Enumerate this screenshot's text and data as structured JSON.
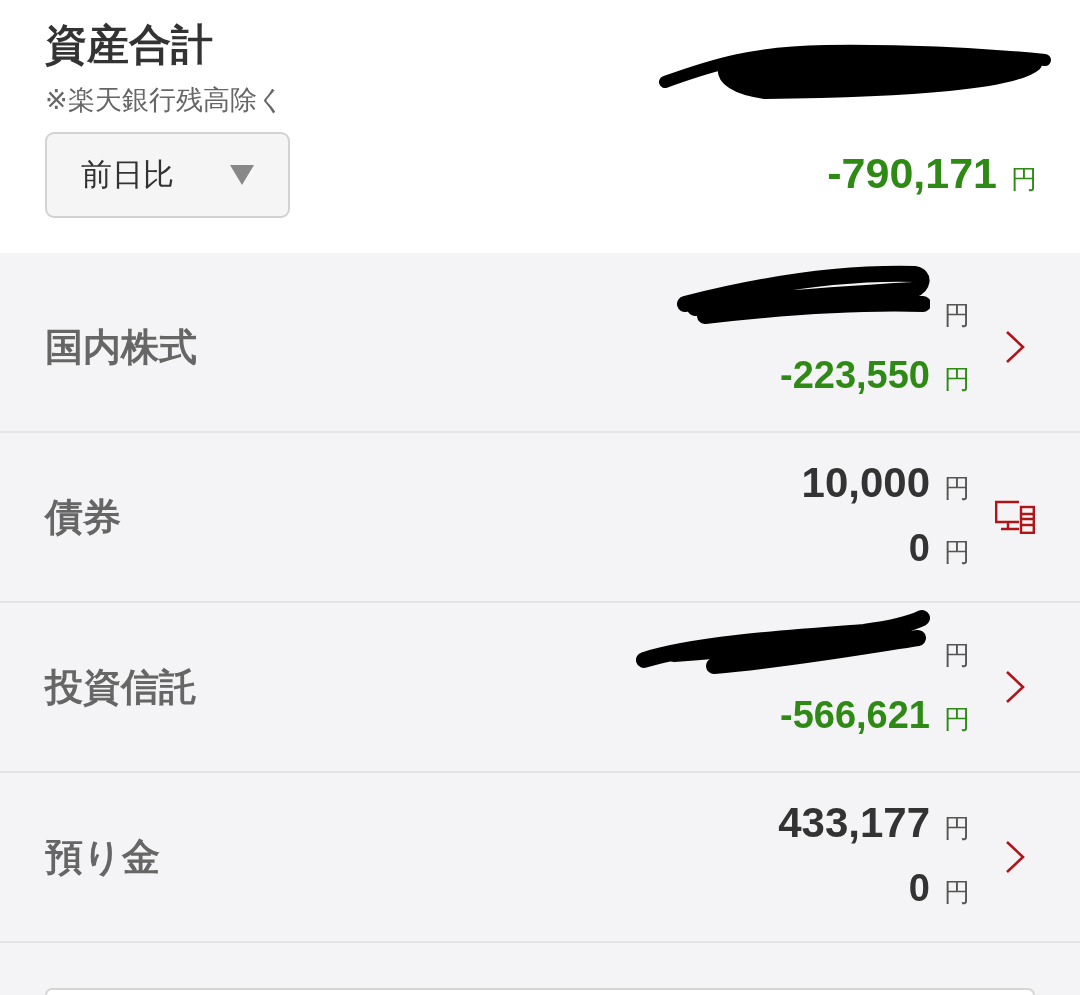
{
  "summary": {
    "title": "資産合計",
    "note": "※楽天銀行残高除く",
    "comparison": {
      "value": "前日比"
    },
    "total": {
      "redacted": true
    },
    "change": {
      "value": "-790,171",
      "unit": "円",
      "negative": true
    }
  },
  "assets": [
    {
      "label": "国内株式",
      "kind": "link",
      "amount": {
        "redacted": true,
        "unit": "円"
      },
      "change": {
        "value": "-223,550",
        "unit": "円",
        "negative": true
      }
    },
    {
      "label": "債券",
      "kind": "desktop",
      "amount": {
        "redacted": false,
        "value": "10,000",
        "unit": "円"
      },
      "change": {
        "value": "0",
        "unit": "円",
        "negative": false
      }
    },
    {
      "label": "投資信託",
      "kind": "link",
      "amount": {
        "redacted": true,
        "unit": "円"
      },
      "change": {
        "value": "-566,621",
        "unit": "円",
        "negative": true
      }
    },
    {
      "label": "預り金",
      "kind": "link",
      "amount": {
        "redacted": false,
        "value": "433,177",
        "unit": "円"
      },
      "change": {
        "value": "0",
        "unit": "円",
        "negative": false
      }
    }
  ]
}
